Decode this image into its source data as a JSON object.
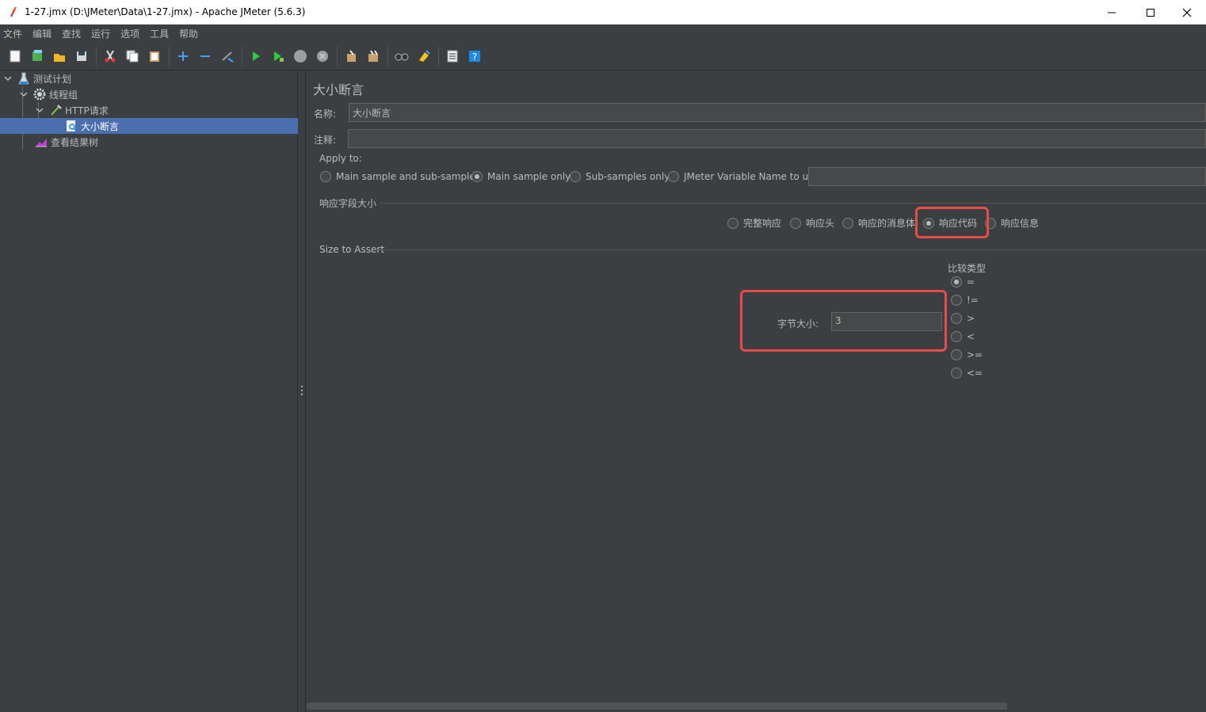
{
  "window": {
    "title": "1-27.jmx (D:\\JMeter\\Data\\1-27.jmx) - Apache JMeter (5.6.3)",
    "minimize": "—",
    "maximize": "☐",
    "close": "✕"
  },
  "menu": [
    "文件",
    "编辑",
    "查找",
    "运行",
    "选项",
    "工具",
    "帮助"
  ],
  "toolbar": [
    "new-icon",
    "templates-icon",
    "open-icon",
    "save-icon",
    "cut-icon",
    "copy-icon",
    "paste-icon",
    "expand-icon",
    "collapse-icon",
    "toggle-icon",
    "start-icon",
    "start-no-pause-icon",
    "stop-icon",
    "shutdown-icon",
    "clear-icon",
    "clear-all-icon",
    "search-icon",
    "reset-search-icon",
    "function-helper-icon",
    "help-icon"
  ],
  "tree": {
    "items": [
      {
        "label": "测试计划"
      },
      {
        "label": "线程组"
      },
      {
        "label": "HTTP请求"
      },
      {
        "label": "大小断言"
      },
      {
        "label": "查看结果树"
      }
    ]
  },
  "panel": {
    "title": "大小断言",
    "name_label": "名称:",
    "name_value": "大小断言",
    "comment_label": "注释:",
    "comment_value": "",
    "apply_to": {
      "title": "Apply to:",
      "options": [
        "Main sample and sub-samples",
        "Main sample only",
        "Sub-samples only",
        "JMeter Variable Name to use"
      ],
      "selected": "Main sample only",
      "variable_value": ""
    },
    "response_field": {
      "title": "响应字段大小",
      "options": [
        "完整响应",
        "响应头",
        "响应的消息体",
        "响应代码",
        "响应信息"
      ],
      "selected": "响应代码"
    },
    "size_assert": {
      "title": "Size to Assert",
      "size_label": "字节大小:",
      "size_value": "3",
      "compare_title": "比较类型",
      "compare_options": [
        "=",
        "!=",
        ">",
        "<",
        ">=",
        "<="
      ],
      "compare_selected": "="
    }
  },
  "colors": {
    "background": "#3c3f41",
    "selection": "#4b6eaf",
    "highlight": "#e74c4c"
  }
}
